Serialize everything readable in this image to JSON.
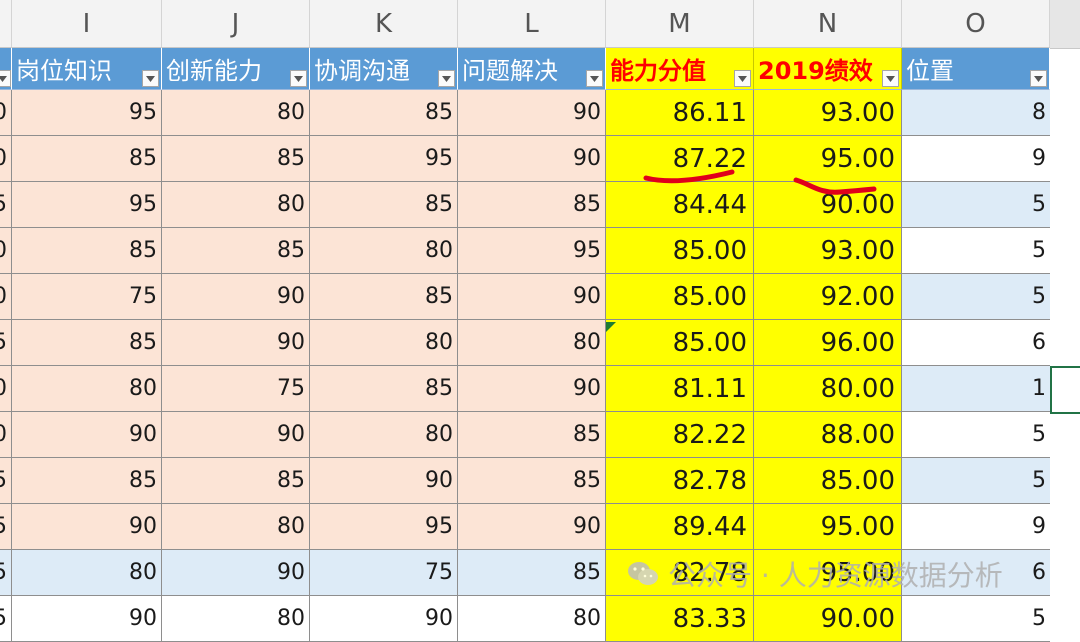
{
  "columns": [
    "I",
    "J",
    "K",
    "L",
    "M",
    "N",
    "O"
  ],
  "headers": [
    {
      "label": "岗位知识",
      "style": "blue"
    },
    {
      "label": "创新能力",
      "style": "blue"
    },
    {
      "label": "协调沟通",
      "style": "blue"
    },
    {
      "label": "问题解决",
      "style": "blue"
    },
    {
      "label": "能力分值",
      "style": "yellow"
    },
    {
      "label": "2019绩效",
      "style": "yellow"
    },
    {
      "label": "位置",
      "style": "blue"
    }
  ],
  "rows": [
    {
      "h": "0",
      "i": "95",
      "j": "80",
      "k": "85",
      "l": "90",
      "m": "86.11",
      "n": "93.00",
      "o": "8",
      "band": "peach",
      "oband": "lblue"
    },
    {
      "h": "0",
      "i": "85",
      "j": "85",
      "k": "95",
      "l": "90",
      "m": "87.22",
      "n": "95.00",
      "o": "9",
      "band": "peach",
      "oband": "white"
    },
    {
      "h": "5",
      "i": "95",
      "j": "80",
      "k": "85",
      "l": "85",
      "m": "84.44",
      "n": "90.00",
      "o": "5",
      "band": "peach",
      "oband": "lblue"
    },
    {
      "h": "0",
      "i": "85",
      "j": "85",
      "k": "80",
      "l": "95",
      "m": "85.00",
      "n": "93.00",
      "o": "5",
      "band": "peach",
      "oband": "white"
    },
    {
      "h": "0",
      "i": "75",
      "j": "90",
      "k": "85",
      "l": "90",
      "m": "85.00",
      "n": "92.00",
      "o": "5",
      "band": "peach",
      "oband": "lblue"
    },
    {
      "h": "5",
      "i": "85",
      "j": "90",
      "k": "80",
      "l": "80",
      "m": "85.00",
      "n": "96.00",
      "o": "6",
      "band": "peach",
      "oband": "white"
    },
    {
      "h": "0",
      "i": "80",
      "j": "75",
      "k": "85",
      "l": "90",
      "m": "81.11",
      "n": "80.00",
      "o": "1",
      "band": "peach",
      "oband": "lblue"
    },
    {
      "h": "0",
      "i": "90",
      "j": "90",
      "k": "80",
      "l": "85",
      "m": "82.22",
      "n": "88.00",
      "o": "5",
      "band": "peach",
      "oband": "white"
    },
    {
      "h": "5",
      "i": "85",
      "j": "85",
      "k": "90",
      "l": "85",
      "m": "82.78",
      "n": "85.00",
      "o": "5",
      "band": "peach",
      "oband": "lblue"
    },
    {
      "h": "5",
      "i": "90",
      "j": "80",
      "k": "95",
      "l": "90",
      "m": "89.44",
      "n": "95.00",
      "o": "9",
      "band": "peach",
      "oband": "white"
    },
    {
      "h": "5",
      "i": "80",
      "j": "90",
      "k": "75",
      "l": "85",
      "m": "82.78",
      "n": "95.00",
      "o": "6",
      "band": "lblue",
      "oband": "lblue"
    },
    {
      "h": "5",
      "i": "90",
      "j": "80",
      "k": "90",
      "l": "80",
      "m": "83.33",
      "n": "90.00",
      "o": "5",
      "band": "white",
      "oband": "white"
    }
  ],
  "watermark": {
    "text": "公众号 · 人力资源数据分析",
    "icon": "wechat-icon"
  },
  "colors": {
    "header_blue": "#5b9bd5",
    "header_yellow": "#ffff00",
    "header_red_text": "#ff0000",
    "band_peach": "#fce4d6",
    "band_lightblue": "#ddebf7",
    "highlight_yellow": "#ffff00",
    "ink_red": "#e0001b"
  },
  "icons": {
    "filter": "filter-dropdown-icon"
  }
}
